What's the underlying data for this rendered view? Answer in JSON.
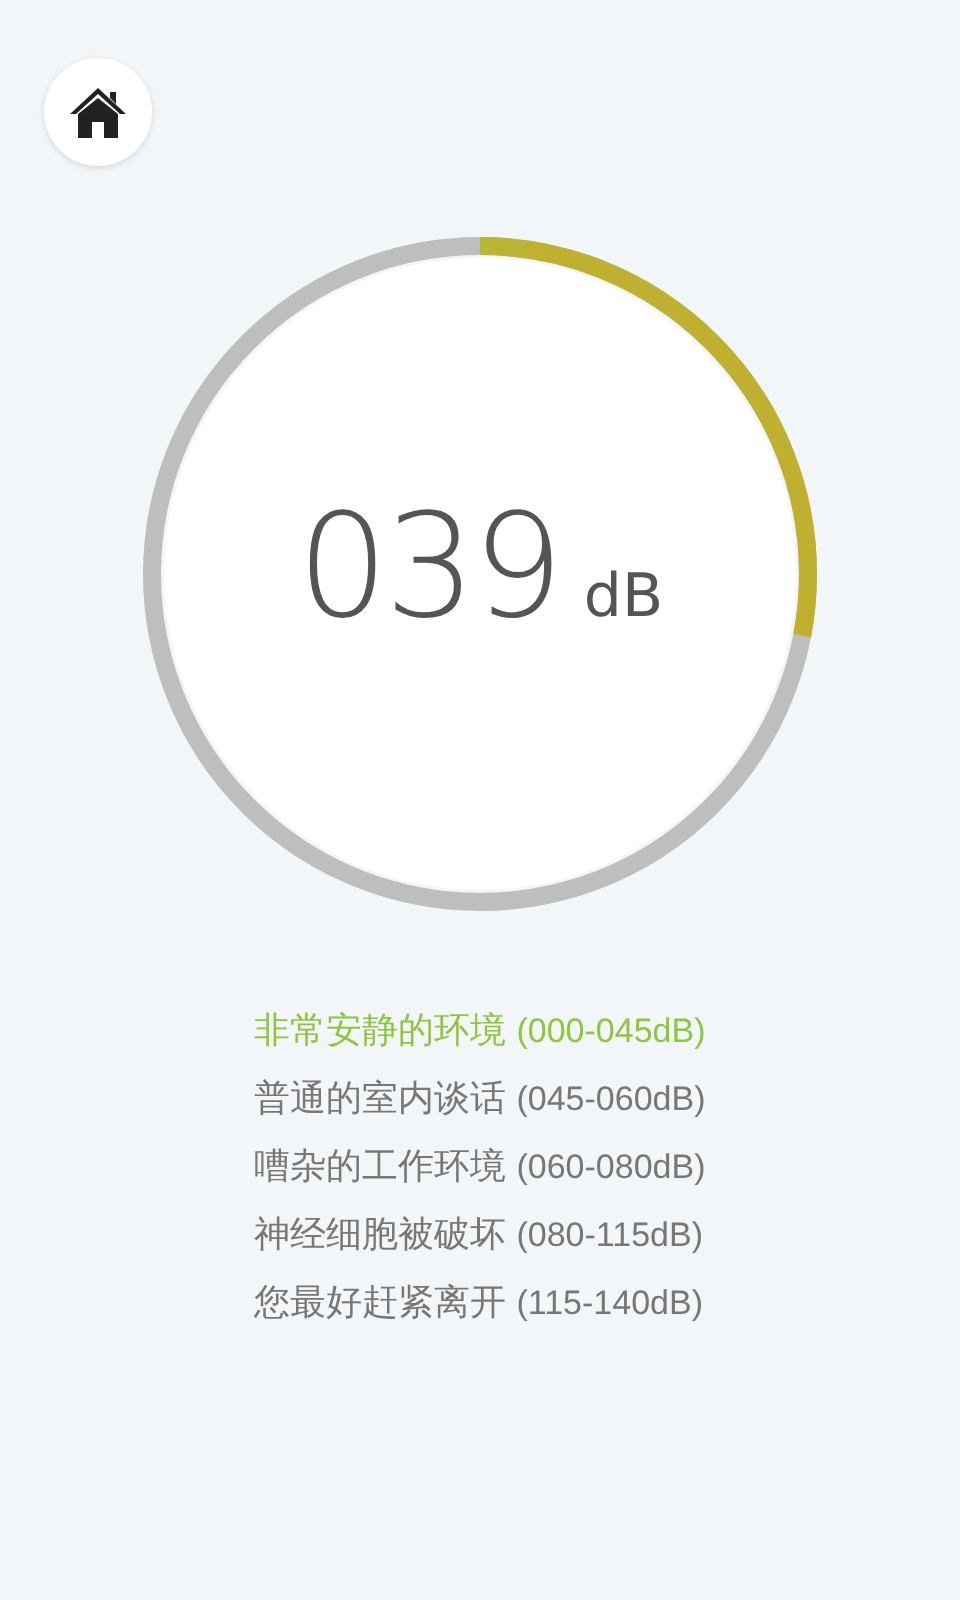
{
  "meter": {
    "reading": "039",
    "unit": "dB",
    "level": 0.28
  },
  "levels": [
    {
      "label": "非常安静的环境",
      "range": "(000-045dB)",
      "selected": true
    },
    {
      "label": "普通的室内谈话",
      "range": "(045-060dB)",
      "selected": false
    },
    {
      "label": "嘈杂的工作环境",
      "range": "(060-080dB)",
      "selected": false
    },
    {
      "label": "神经细胞被破坏",
      "range": "(080-115dB)",
      "selected": false
    },
    {
      "label": "您最好赶紧离开",
      "range": "(115-140dB)",
      "selected": false
    }
  ]
}
